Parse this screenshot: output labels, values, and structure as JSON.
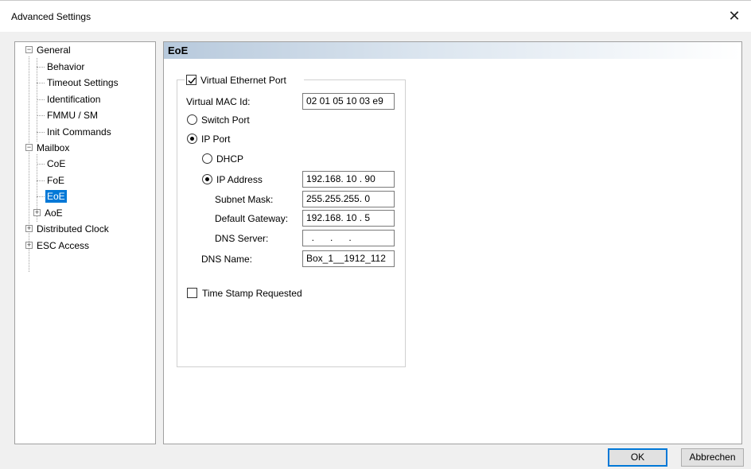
{
  "window": {
    "title": "Advanced Settings",
    "close_glyph": "✕"
  },
  "tree": {
    "general": "General",
    "behavior": "Behavior",
    "timeout_settings": "Timeout Settings",
    "identification": "Identification",
    "fmmu_sm": "FMMU / SM",
    "init_commands": "Init Commands",
    "mailbox": "Mailbox",
    "coe": "CoE",
    "foe": "FoE",
    "eoe": "EoE",
    "aoe": "AoE",
    "distributed_clock": "Distributed Clock",
    "esc_access": "ESC Access",
    "selected": "EoE",
    "expander_collapsed": "+",
    "expander_expanded": "−"
  },
  "panel": {
    "header": "EoE",
    "virtual_ethernet_port": {
      "label": "Virtual Ethernet Port",
      "checked": true
    },
    "virtual_mac_label": "Virtual MAC Id:",
    "virtual_mac_value": "02 01 05 10 03 e9",
    "switch_port": {
      "label": "Switch Port",
      "selected": false
    },
    "ip_port": {
      "label": "IP Port",
      "selected": true
    },
    "dhcp": {
      "label": "DHCP",
      "selected": false
    },
    "ip_address": {
      "label": "IP Address",
      "selected": true,
      "value": "192.168. 10 . 90"
    },
    "subnet_mask": {
      "label": "Subnet Mask:",
      "value": "255.255.255. 0"
    },
    "default_gateway": {
      "label": "Default Gateway:",
      "value": "192.168. 10 . 5"
    },
    "dns_server": {
      "label": "DNS Server:",
      "value": "  .      .      ."
    },
    "dns_name": {
      "label": "DNS Name:",
      "value": "Box_1__1912_112"
    },
    "time_stamp_requested": {
      "label": "Time Stamp Requested",
      "checked": false
    }
  },
  "buttons": {
    "ok": "OK",
    "cancel": "Abbrechen"
  }
}
